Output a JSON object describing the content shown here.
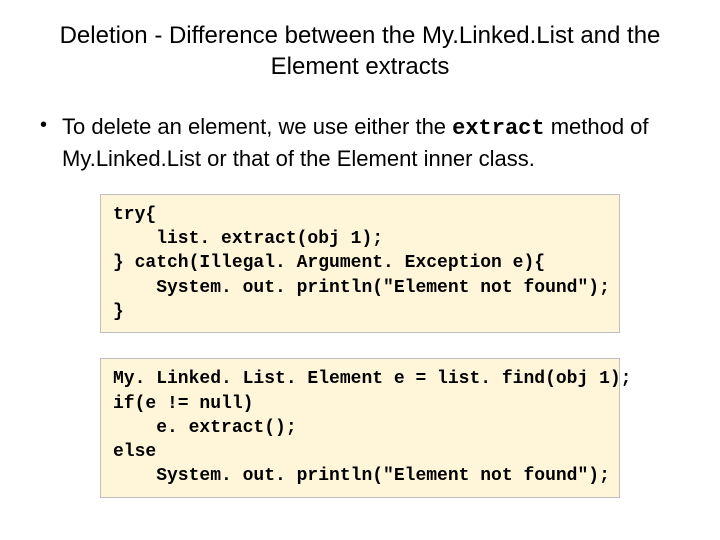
{
  "title": "Deletion - Difference between the My.Linked.List and the Element extracts",
  "bullet": {
    "marker": "•",
    "before": "To delete an element, we use either the ",
    "code_word": "extract",
    "after": " method of My.Linked.List or that of the Element inner class."
  },
  "code1": "try{\n    list. extract(obj 1);\n} catch(Illegal. Argument. Exception e){\n    System. out. println(\"Element not found\");\n}",
  "code2": "My. Linked. List. Element e = list. find(obj 1);\nif(e != null)\n    e. extract();\nelse\n    System. out. println(\"Element not found\");"
}
